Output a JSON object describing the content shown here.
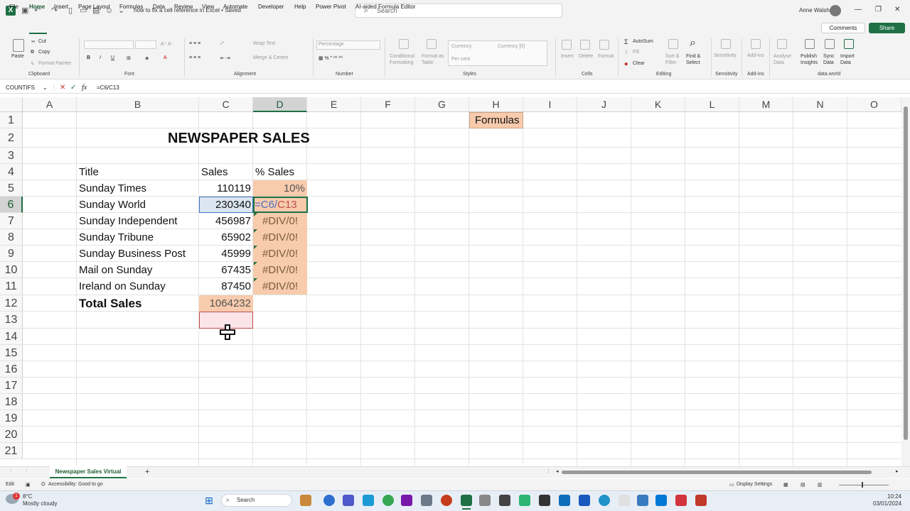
{
  "window": {
    "title": "how to fix a cell reference in Excel • Saved",
    "search_placeholder": "Search",
    "user_name": "Anne Walsh"
  },
  "menu": {
    "tabs": [
      "File",
      "Home",
      "Insert",
      "Page Layout",
      "Formulas",
      "Data",
      "Review",
      "View",
      "Automate",
      "Developer",
      "Help",
      "Power Pivot",
      "AI-aided Formula Editor"
    ],
    "active": "Home",
    "comments_label": "Comments",
    "share_label": "Share"
  },
  "ribbon": {
    "clipboard": {
      "paste": "Paste",
      "cut": "Cut",
      "copy": "Copy",
      "format_painter": "Format Painter",
      "label": "Clipboard"
    },
    "font": {
      "label": "Font"
    },
    "alignment": {
      "wrap_text": "Wrap Text",
      "merge_center": "Merge & Centre",
      "label": "Alignment"
    },
    "number": {
      "format": "Percentage",
      "label": "Number"
    },
    "styles": {
      "conditional": "Conditional Formatting",
      "format_table": "Format as Table",
      "currency": "Currency",
      "currency0": "Currency [0]",
      "percent": "Per cent",
      "label": "Styles"
    },
    "cells": {
      "insert": "Insert",
      "delete": "Delete",
      "format": "Format",
      "label": "Cells"
    },
    "editing": {
      "autosum": "AutoSum",
      "fill": "Fill",
      "clear": "Clear",
      "sort_filter": "Sort & Filter",
      "find_select": "Find & Select",
      "label": "Editing"
    },
    "sensitivity": {
      "btn": "Sensitivity",
      "label": "Sensitivity"
    },
    "addins": {
      "btn": "Add-ins",
      "label": "Add-ins"
    },
    "dataworld": {
      "analyse": "Analyse Data",
      "publish": "Publish Insights",
      "sync": "Sync Data",
      "import": "Import Data",
      "label": "data.world"
    }
  },
  "formula_bar": {
    "name_box": "COUNTIFS",
    "content": "=C6/C13"
  },
  "columns": [
    "A",
    "B",
    "C",
    "D",
    "E",
    "F",
    "G",
    "H",
    "I",
    "J",
    "K",
    "L",
    "M",
    "N",
    "O"
  ],
  "rows": [
    "1",
    "2",
    "3",
    "4",
    "5",
    "6",
    "7",
    "8",
    "9",
    "10",
    "11",
    "12",
    "13",
    "14",
    "15",
    "16",
    "17",
    "18",
    "19",
    "20",
    "21"
  ],
  "sheet": {
    "title": "NEWSPAPER SALES",
    "formulas_label": "Formulas",
    "headers": {
      "title": "Title",
      "sales": "Sales",
      "pct": "% Sales"
    },
    "rows": [
      {
        "title": "Sunday Times",
        "sales": "110119",
        "pct": "10%"
      },
      {
        "title": "Sunday World",
        "sales": "230340",
        "pct": "=C6/C13"
      },
      {
        "title": "Sunday Independent",
        "sales": "456987",
        "pct": "#DIV/0!"
      },
      {
        "title": "Sunday Tribune",
        "sales": "65902",
        "pct": "#DIV/0!"
      },
      {
        "title": "Sunday Business Post",
        "sales": "45999",
        "pct": "#DIV/0!"
      },
      {
        "title": "Mail on Sunday",
        "sales": "67435",
        "pct": "#DIV/0!"
      },
      {
        "title": "Ireland on Sunday",
        "sales": "87450",
        "pct": "#DIV/0!"
      }
    ],
    "total_label": "Total Sales",
    "total_value": "1064232",
    "edit_ref_1": "=C6/",
    "edit_ref_2": "C13"
  },
  "tabs": {
    "sheet_name": "Newspaper Sales Virtual",
    "add": "+"
  },
  "status": {
    "mode": "Edit",
    "accessibility": "Accessibility: Good to go",
    "display": "Display Settings"
  },
  "taskbar": {
    "weather_temp": "8°C",
    "weather_desc": "Mostly cloudy",
    "search": "Search",
    "time": "10:24",
    "date": "03/01/2024",
    "notif": "1"
  },
  "colors": {
    "accent": "#1e7145",
    "fill": "#f8cbad",
    "selection": "#dce6f2"
  }
}
